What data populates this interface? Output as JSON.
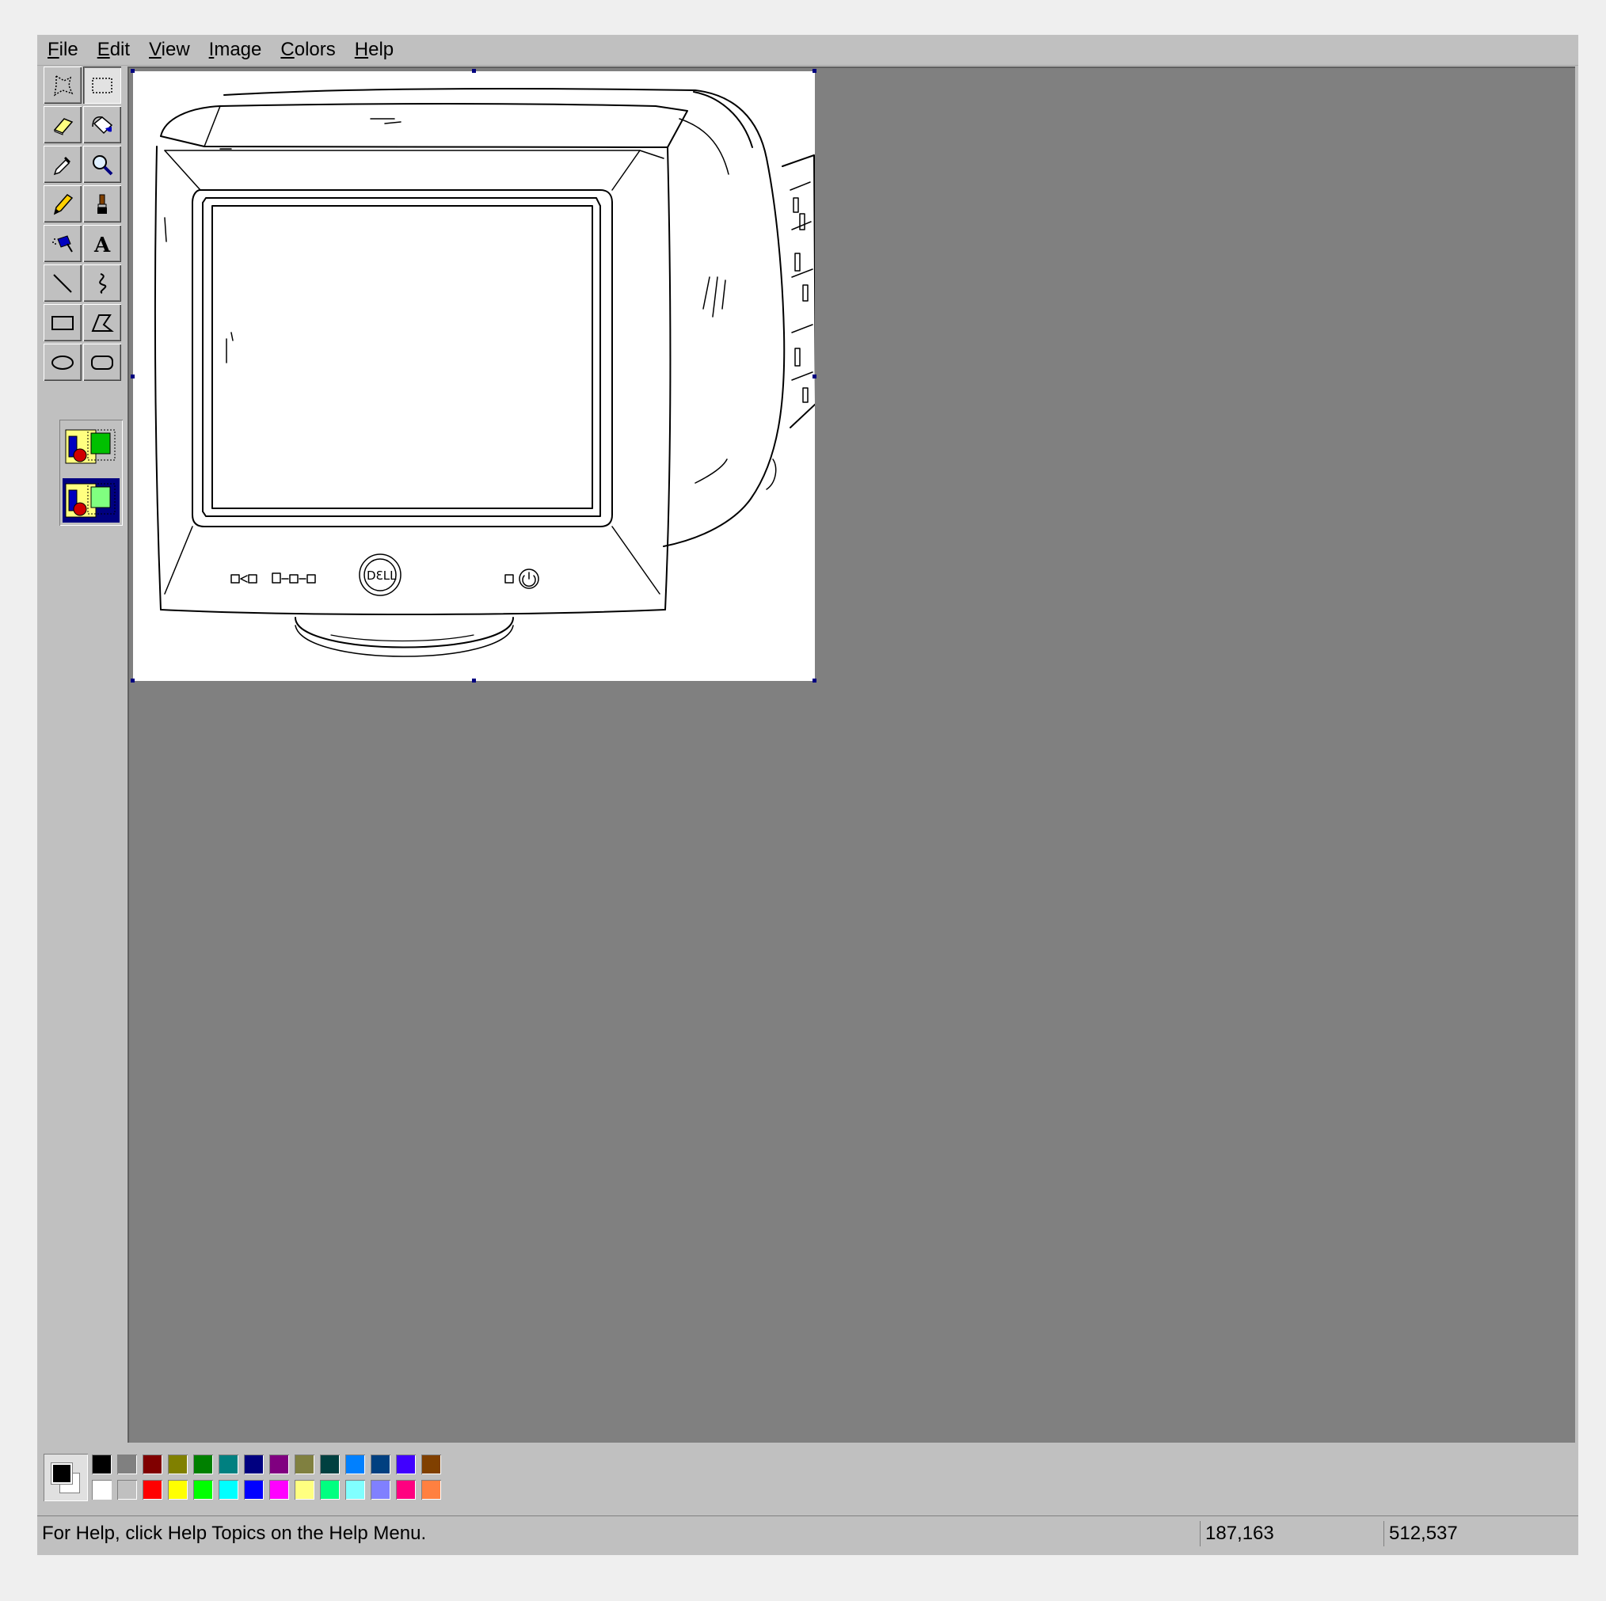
{
  "menu": {
    "items": [
      {
        "label": "File",
        "ul": "F",
        "rest": "ile"
      },
      {
        "label": "Edit",
        "ul": "E",
        "rest": "dit"
      },
      {
        "label": "View",
        "ul": "V",
        "rest": "iew"
      },
      {
        "label": "Image",
        "ul": "I",
        "rest": "mage"
      },
      {
        "label": "Colors",
        "ul": "C",
        "rest": "olors"
      },
      {
        "label": "Help",
        "ul": "H",
        "rest": "elp"
      }
    ]
  },
  "toolbox": {
    "tools": [
      {
        "name": "free-form-select",
        "icon": "free-select-icon"
      },
      {
        "name": "select",
        "icon": "rect-select-icon",
        "selected": true
      },
      {
        "name": "eraser",
        "icon": "eraser-icon"
      },
      {
        "name": "fill",
        "icon": "fill-bucket-icon"
      },
      {
        "name": "pick-color",
        "icon": "eyedropper-icon"
      },
      {
        "name": "magnifier",
        "icon": "magnifier-icon"
      },
      {
        "name": "pencil",
        "icon": "pencil-icon"
      },
      {
        "name": "brush",
        "icon": "brush-icon"
      },
      {
        "name": "airbrush",
        "icon": "airbrush-icon"
      },
      {
        "name": "text",
        "icon": "text-icon",
        "glyph": "A"
      },
      {
        "name": "line",
        "icon": "line-icon"
      },
      {
        "name": "curve",
        "icon": "curve-icon"
      },
      {
        "name": "rectangle",
        "icon": "rectangle-icon"
      },
      {
        "name": "polygon",
        "icon": "polygon-icon"
      },
      {
        "name": "ellipse",
        "icon": "ellipse-icon"
      },
      {
        "name": "rounded-rectangle",
        "icon": "rounded-rect-icon"
      }
    ],
    "options": [
      {
        "name": "opaque-selection",
        "icon": "opaque-selection-icon",
        "selected": false
      },
      {
        "name": "transparent-selection",
        "icon": "transparent-selection-icon",
        "selected": true
      }
    ]
  },
  "palette": {
    "foreground": "#000000",
    "background": "#ffffff",
    "top_row": [
      "#000000",
      "#808080",
      "#800000",
      "#808000",
      "#008000",
      "#008080",
      "#000080",
      "#800080",
      "#808040",
      "#004040",
      "#0080ff",
      "#004080",
      "#4000ff",
      "#804000"
    ],
    "bottom_row": [
      "#ffffff",
      "#c0c0c0",
      "#ff0000",
      "#ffff00",
      "#00ff00",
      "#00ffff",
      "#0000ff",
      "#ff00ff",
      "#ffff80",
      "#00ff80",
      "#80ffff",
      "#8080ff",
      "#ff0080",
      "#ff8040"
    ]
  },
  "status": {
    "help_text": "For Help, click Help Topics on the Help Menu.",
    "cursor_pos": "187,163",
    "image_size": "512,537"
  },
  "canvas": {
    "image_subject": "monitor-drawing"
  }
}
